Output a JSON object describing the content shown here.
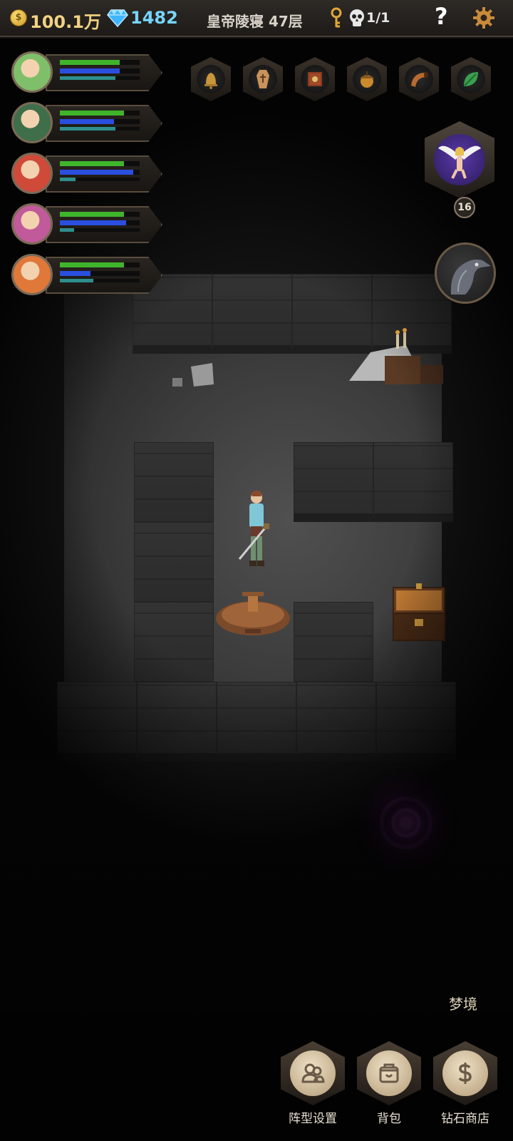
{
  "topbar": {
    "coin_symbol": "$",
    "gold": "100.1万",
    "gems": "1482",
    "floor": "皇帝陵寝 47层",
    "kills": "1/1",
    "help": "?"
  },
  "party": {
    "members": [
      {
        "name": "hero-1",
        "hp": 0.75,
        "mp": 0.75,
        "xp": 0.7,
        "portrait_color": "#7fbf6a"
      },
      {
        "name": "hero-2",
        "hp": 0.8,
        "mp": 0.68,
        "xp": 0.7,
        "portrait_color": "#3f6e4a"
      },
      {
        "name": "hero-3",
        "hp": 0.8,
        "mp": 0.92,
        "xp": 0.2,
        "portrait_color": "#d04a3a"
      },
      {
        "name": "hero-4",
        "hp": 0.8,
        "mp": 0.83,
        "xp": 0.18,
        "portrait_color": "#c05a9a"
      },
      {
        "name": "hero-5",
        "hp": 0.8,
        "mp": 0.38,
        "xp": 0.42,
        "portrait_color": "#e0783a"
      }
    ]
  },
  "relics": [
    "bell-icon",
    "coffin-icon",
    "book-icon",
    "acorn-icon",
    "horn-icon",
    "leaf-icon"
  ],
  "companion": {
    "level": "16"
  },
  "actions": {
    "dream": "梦境",
    "formation": "阵型设置",
    "bag": "背包",
    "shop": "钻石商店"
  },
  "colors": {
    "gold": "#f1d283",
    "gem": "#76d5ff",
    "hp": "#3fb52c",
    "mp": "#2a4fe0",
    "portal": "#b040c0"
  }
}
